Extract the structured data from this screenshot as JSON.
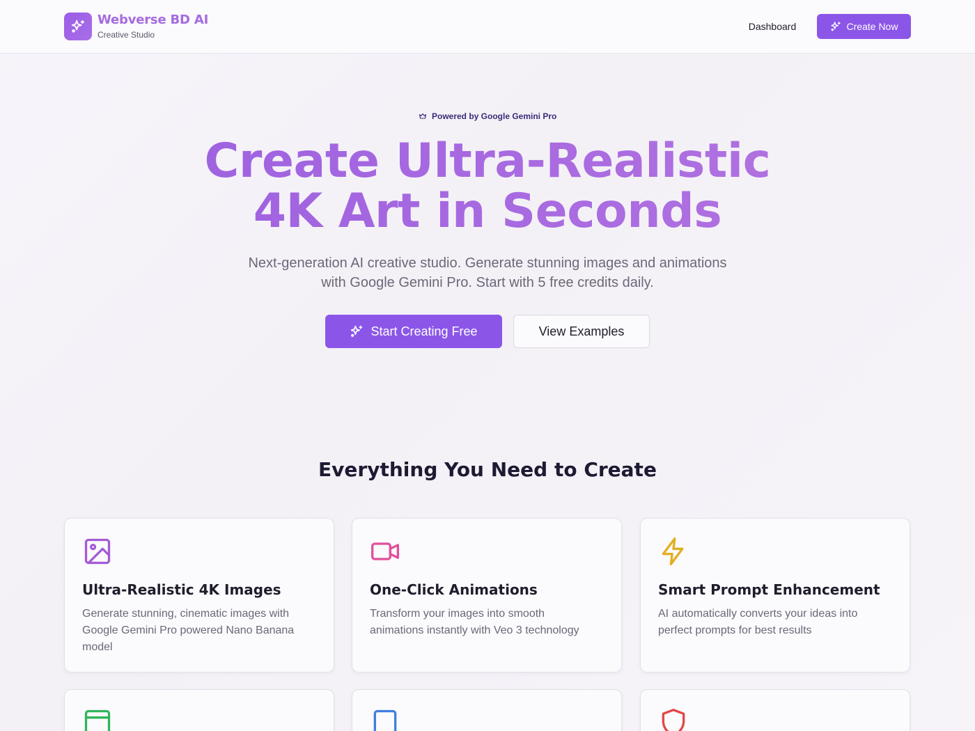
{
  "header": {
    "brand_name": "Webverse BD AI",
    "brand_sub": "Creative Studio",
    "nav_dashboard": "Dashboard",
    "nav_create": "Create Now"
  },
  "hero": {
    "badge": "Powered by Google Gemini Pro",
    "title_line1": "Create Ultra-Realistic",
    "title_line2": "4K Art in Seconds",
    "subtitle": "Next-generation AI creative studio. Generate stunning images and animations with Google Gemini Pro. Start with 5 free credits daily.",
    "cta_primary": "Start Creating Free",
    "cta_secondary": "View Examples"
  },
  "features": {
    "section_title": "Everything You Need to Create",
    "cards": [
      {
        "title": "Ultra-Realistic 4K Images",
        "desc": "Generate stunning, cinematic images with Google Gemini Pro powered Nano Banana model",
        "icon": "image-icon",
        "color": "#a35ad8"
      },
      {
        "title": "One-Click Animations",
        "desc": "Transform your images into smooth animations instantly with Veo 3 technology",
        "icon": "video-icon",
        "color": "#e0509a"
      },
      {
        "title": "Smart Prompt Enhancement",
        "desc": "AI automatically converts your ideas into perfect prompts for best results",
        "icon": "zap-icon",
        "color": "#e0b020"
      },
      {
        "title": "",
        "desc": "",
        "icon": "browser-icon",
        "color": "#2fb55a"
      },
      {
        "title": "",
        "desc": "",
        "icon": "square-icon",
        "color": "#3f7fe0"
      },
      {
        "title": "",
        "desc": "",
        "icon": "shield-icon",
        "color": "#e04848"
      }
    ]
  },
  "colors": {
    "accent": "#8b56e8",
    "brand_text": "#a56be0"
  }
}
